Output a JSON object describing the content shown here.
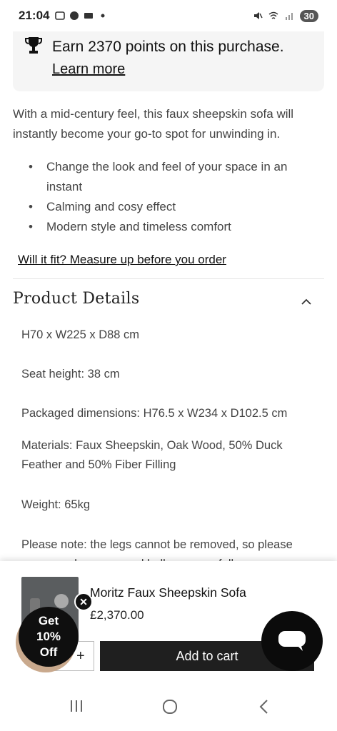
{
  "status_bar": {
    "time": "21:04",
    "battery": "30"
  },
  "points_card": {
    "text": "Earn 2370 points on this purchase.",
    "link": "Learn more"
  },
  "description": "With a mid-century feel, this faux sheepskin sofa will instantly become your go-to spot for unwinding in.",
  "bullets": [
    "Change the look and feel of your space in an instant",
    "Calming and cosy effect",
    "Modern style and timeless comfort"
  ],
  "fit_link": "Will it fit? Measure up before you order",
  "details": {
    "title": "Product Details",
    "items": [
      "H70 x W225 x D88 cm",
      "Seat height: 38 cm",
      "Packaged dimensions: H76.5 x W234 x D102.5 cm",
      "Materials: Faux Sheepskin, Oak Wood, 50% Duck Feather and 50% Fiber Filling",
      "Weight: 65kg",
      "Please note: the legs cannot be removed, so please measure doorways and hallways carefully"
    ]
  },
  "sticky": {
    "product_name": "Moritz Faux Sheepskin Sofa",
    "price": "£2,370.00",
    "plus": "+",
    "add_to_cart": "Add to cart"
  },
  "promo": {
    "line1": "Get",
    "line2": "10%",
    "line3": "Off"
  },
  "icons": [
    "trophy-icon",
    "chevron-up-icon",
    "close-icon",
    "chat-icon",
    "recents-icon",
    "home-icon",
    "back-icon"
  ]
}
